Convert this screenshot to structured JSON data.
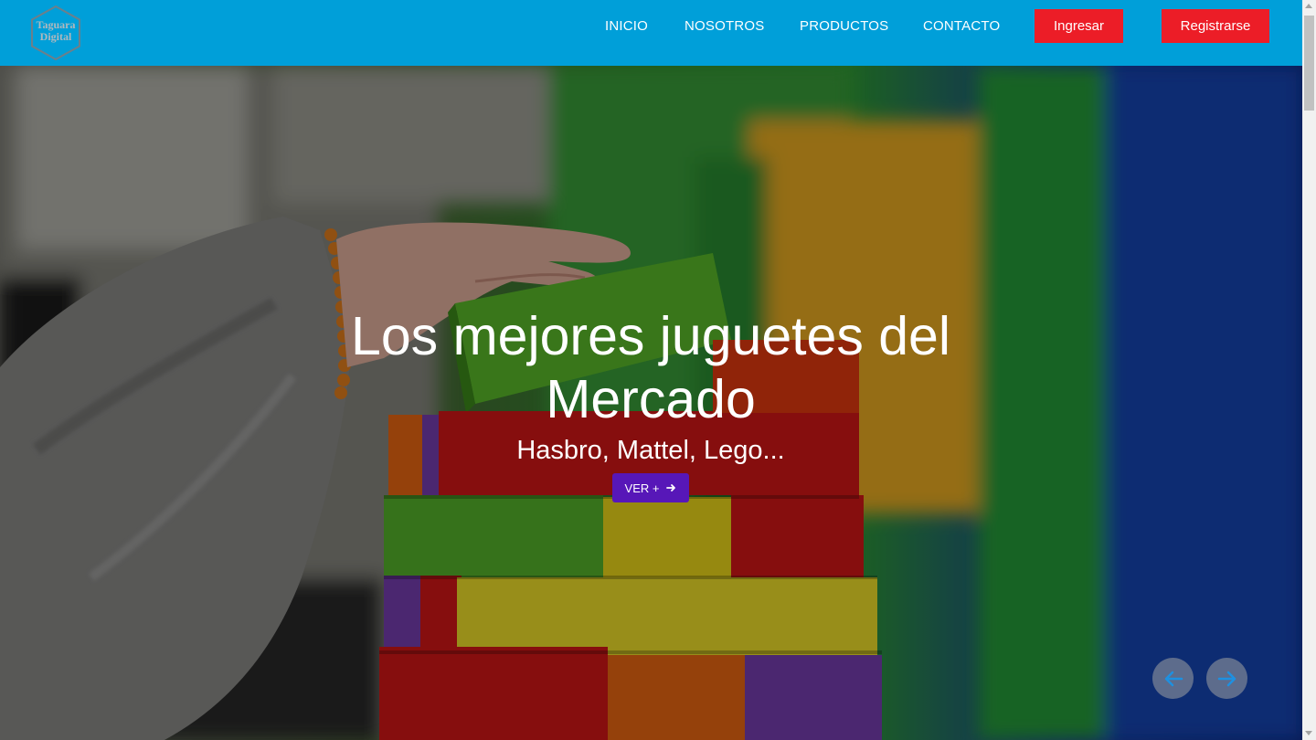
{
  "brand": {
    "logo_text": "Taguara Digital",
    "color": "#009fd9"
  },
  "nav": {
    "items": [
      {
        "label": "INICIO"
      },
      {
        "label": "NOSOTROS"
      },
      {
        "label": "PRODUCTOS"
      },
      {
        "label": "CONTACTO"
      }
    ],
    "login_label": "Ingresar",
    "register_label": "Registrarse",
    "button_color": "#ec1d27"
  },
  "hero": {
    "title": "Los mejores juguetes del Mercado",
    "subtitle": "Hasbro, Mattel, Lego...",
    "cta_label": "VER +",
    "cta_icon": "arrow-right-icon",
    "cta_color": "#5717b8",
    "image": "hand-stacking-colorful-wooden-blocks",
    "prev_icon": "arrow-left-icon",
    "next_icon": "arrow-right-icon"
  }
}
